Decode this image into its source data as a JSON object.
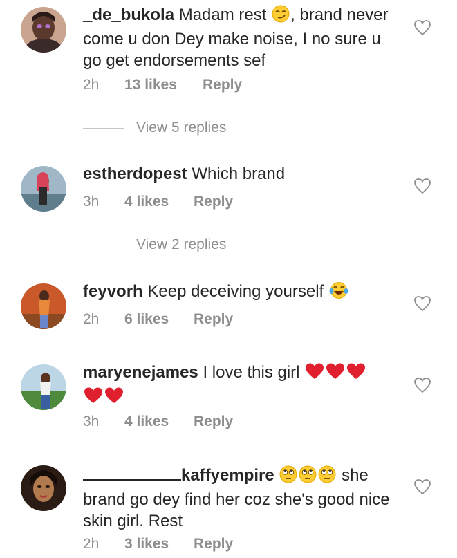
{
  "comments": [
    {
      "username": "_de_bukola",
      "text_part1": " Madam rest ",
      "text_part2": ", brand never come u don Dey make noise, I no sure u go get endorsements sef",
      "time": "2h",
      "likes": "13 likes",
      "reply": "Reply",
      "view_replies": "View 5 replies"
    },
    {
      "username": "estherdopest",
      "text": " Which brand",
      "time": "3h",
      "likes": "4 likes",
      "reply": "Reply",
      "view_replies": "View 2 replies"
    },
    {
      "username": "feyvorh",
      "text": " Keep deceiving yourself ",
      "time": "2h",
      "likes": "6 likes",
      "reply": "Reply"
    },
    {
      "username": "maryenejames",
      "text": " I love this girl ",
      "time": "3h",
      "likes": "4 likes",
      "reply": "Reply"
    },
    {
      "username": "kaffyempire",
      "text_part1": " she brand go dey find her coz she's good nice skin girl. Rest",
      "time": "2h",
      "likes": "3 likes",
      "reply": "Reply"
    }
  ],
  "icons": {
    "like": "heart-outline-icon",
    "smirk": "smirking-face-emoji",
    "laugh": "tears-of-joy-emoji",
    "heart": "red-heart-emoji",
    "eyeroll": "eye-roll-emoji"
  },
  "colors": {
    "text": "#262626",
    "secondary": "#8e8e8e",
    "heart": "#e0202e",
    "emoji_yellow": "#ffcc33"
  }
}
